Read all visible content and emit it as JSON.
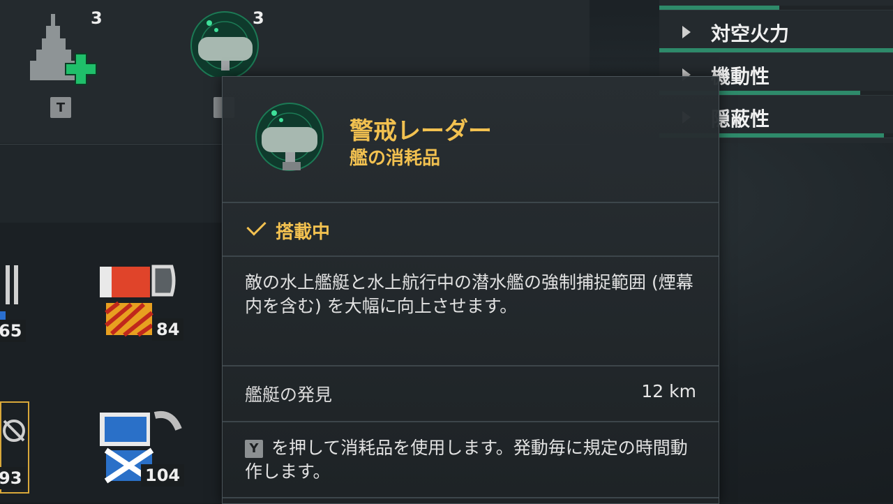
{
  "slots": {
    "heal": {
      "count": "3",
      "tier": "T",
      "icon": "battleship-heal-icon"
    },
    "radar": {
      "count": "3",
      "icon": "radar-icon"
    }
  },
  "flags": [
    {
      "count": "65",
      "icon": "tools-icon"
    },
    {
      "count": "84",
      "icon": "signal-flag-red-white-icon"
    },
    {
      "count": "93",
      "icon": "targeting-icon"
    },
    {
      "count": "104",
      "icon": "signal-flag-blue-white-icon"
    }
  ],
  "stats": [
    {
      "label": "対空火力",
      "bar": 1.0
    },
    {
      "label": "機動性",
      "bar": 0.86
    },
    {
      "label": "隠蔽性",
      "bar": 0.96
    }
  ],
  "tooltip": {
    "title": "警戒レーダー",
    "subtitle": "艦の消耗品",
    "status": "搭載中",
    "description": "敵の水上艦艇と水上航行中の潜水艦の強制捕捉範囲 (煙幕内を含む) を大幅に向上させます。",
    "param_label": "艦艇の発見",
    "param_value": "12 km",
    "key": "Y",
    "hint": "を押して消耗品を使用します。発動毎に規定の時間動作します。"
  },
  "colors": {
    "accent": "#f2c150",
    "bar": "#2e8a6a"
  }
}
